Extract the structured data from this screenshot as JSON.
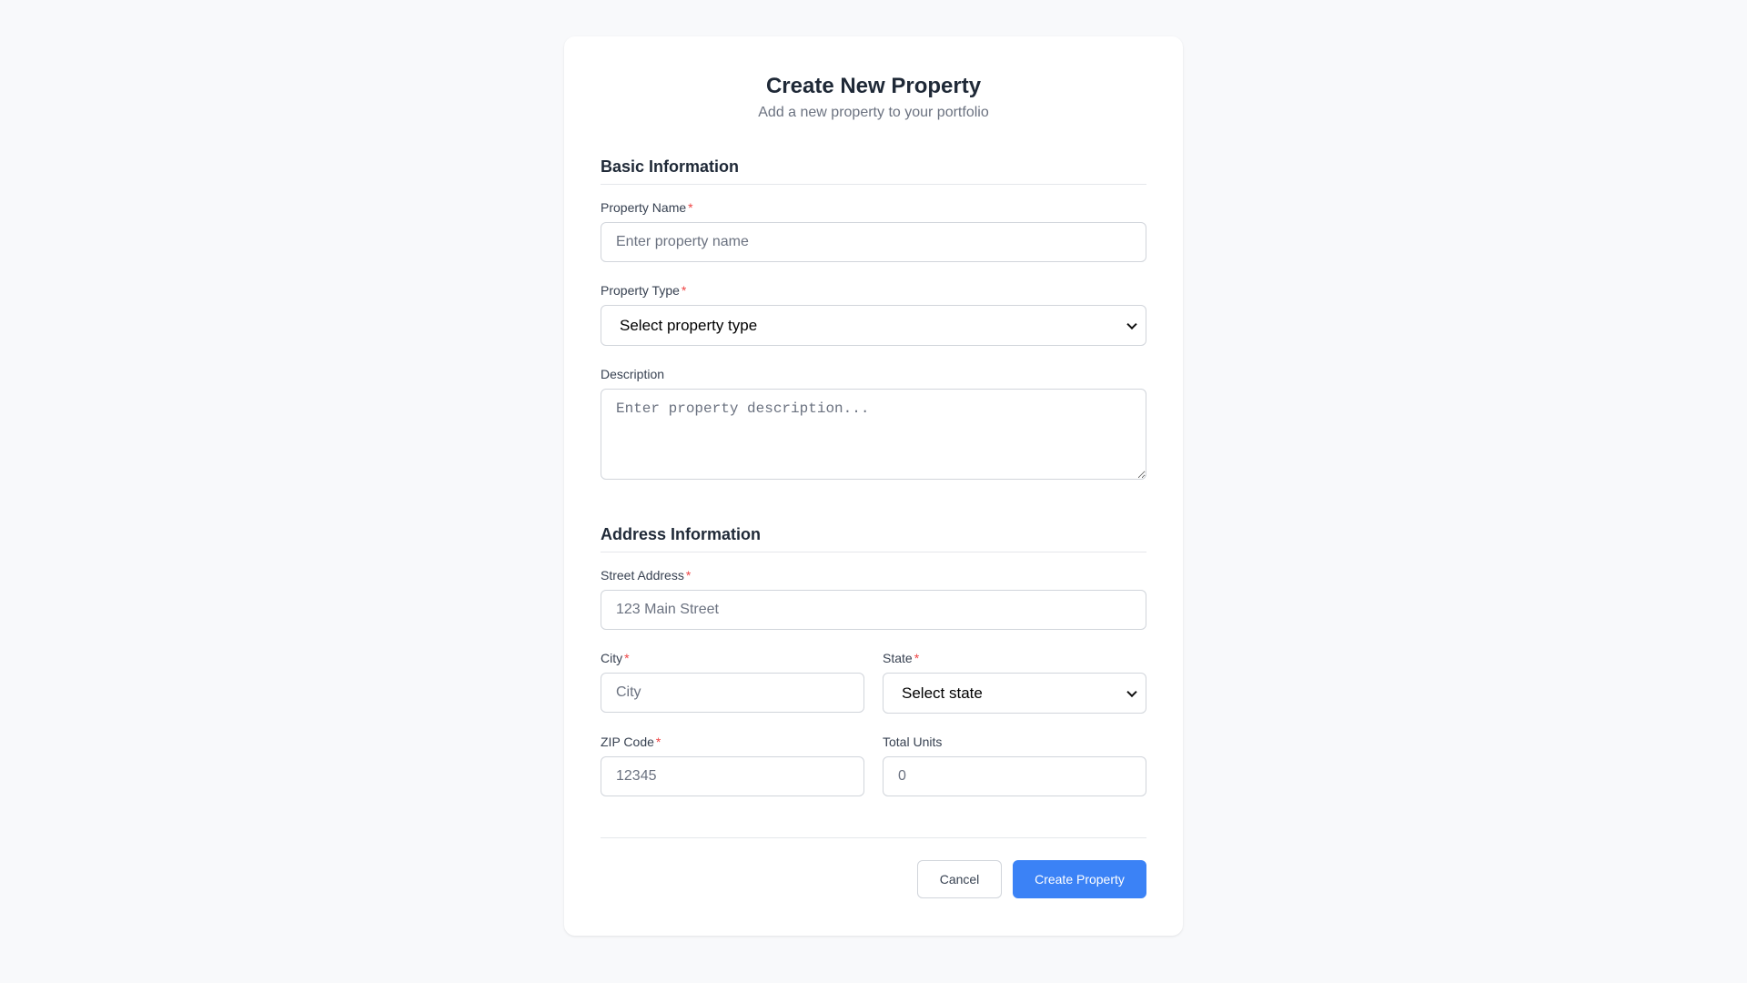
{
  "header": {
    "title": "Create New Property",
    "subtitle": "Add a new property to your portfolio"
  },
  "basic": {
    "section_title": "Basic Information",
    "property_name": {
      "label": "Property Name",
      "required": "*",
      "placeholder": "Enter property name",
      "value": ""
    },
    "property_type": {
      "label": "Property Type",
      "required": "*",
      "selected": "Select property type"
    },
    "description": {
      "label": "Description",
      "placeholder": "Enter property description...",
      "value": ""
    }
  },
  "address": {
    "section_title": "Address Information",
    "street": {
      "label": "Street Address",
      "required": "*",
      "placeholder": "123 Main Street",
      "value": ""
    },
    "city": {
      "label": "City",
      "required": "*",
      "placeholder": "City",
      "value": ""
    },
    "state": {
      "label": "State",
      "required": "*",
      "selected": "Select state"
    },
    "zip": {
      "label": "ZIP Code",
      "required": "*",
      "placeholder": "12345",
      "value": ""
    },
    "units": {
      "label": "Total Units",
      "placeholder": "0",
      "value": ""
    }
  },
  "actions": {
    "cancel_label": "Cancel",
    "submit_label": "Create Property"
  },
  "colors": {
    "primary": "#3b82f6",
    "required": "#ef4444",
    "background": "#f8f9fb",
    "border": "#d1d5db"
  }
}
